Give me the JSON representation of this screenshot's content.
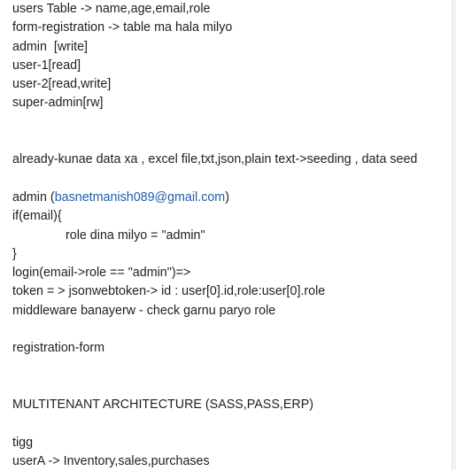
{
  "note": {
    "lines": {
      "l1": "users Table -> name,age,email,role",
      "l2": "form-registration -> table ma hala milyo",
      "l3": "admin  [write]",
      "l4": "user-1[read]",
      "l5": "user-2[read,write]",
      "l6": "super-admin[rw]",
      "l7": "already-kunae data xa , excel file,txt,json,plain text->seeding , data seed",
      "l8_prefix": "admin (",
      "l8_email": "basnetmanish089@gmail.com",
      "l8_suffix": ")",
      "l9": "if(email){",
      "l10": "role dina milyo = \"admin\"",
      "l11": "}",
      "l12": "login(email->role == \"admin\")=>",
      "l13": "token = > jsonwebtoken-> id : user[0].id,role:user[0].role",
      "l14": "middleware banayerw - check garnu paryo role",
      "l15": "registration-form",
      "l16": "MULTITENANT ARCHITECTURE (SASS,PASS,ERP)",
      "l17": "tigg",
      "l18": "userA -> Inventory,sales,purchases"
    },
    "colors": {
      "text": "#1f1f1f",
      "link": "#1f5fa8"
    }
  }
}
